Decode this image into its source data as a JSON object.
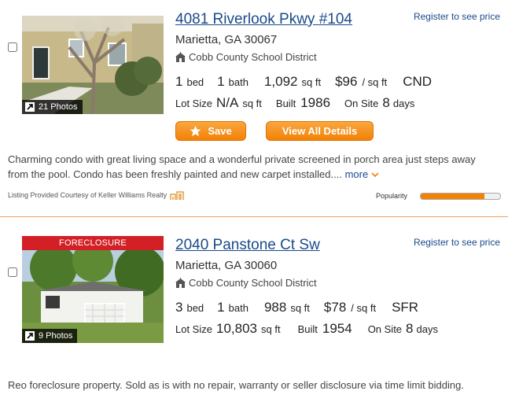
{
  "listings": [
    {
      "address": "4081 Riverlook Pkwy #104",
      "register_text": "Register to see price",
      "city": "Marietta, GA 30067",
      "school": "Cobb County School District",
      "beds_value": "1",
      "beds_label": "bed",
      "baths_value": "1",
      "baths_label": "bath",
      "sqft_value": "1,092",
      "sqft_label": "sq ft",
      "price_per_sqft": "$96",
      "price_per_sqft_label": "/ sq ft",
      "type": "CND",
      "lot_label": "Lot Size",
      "lot_value": "N/A",
      "lot_unit": "sq ft",
      "built_label": "Built",
      "built_value": "1986",
      "onsite_label": "On Site",
      "onsite_value": "8",
      "onsite_unit": "days",
      "photos": "21 Photos",
      "save_label": "Save",
      "details_label": "View All Details",
      "description": "Charming condo with great living space and a wonderful private screened in porch area just steps away from the pool. Condo has been freshly painted and new carpet installed....",
      "more_label": "more",
      "courtesy": "Listing Provided Courtesy of Keller Williams Realty",
      "popularity_label": "Popularity",
      "popularity": 0.8
    },
    {
      "banner": "FORECLOSURE",
      "address": "2040 Panstone Ct Sw",
      "register_text": "Register to see price",
      "city": "Marietta, GA 30060",
      "school": "Cobb County School District",
      "beds_value": "3",
      "beds_label": "bed",
      "baths_value": "1",
      "baths_label": "bath",
      "sqft_value": "988",
      "sqft_label": "sq ft",
      "price_per_sqft": "$78",
      "price_per_sqft_label": "/ sq ft",
      "type": "SFR",
      "lot_label": "Lot Size",
      "lot_value": "10,803",
      "lot_unit": "sq ft",
      "built_label": "Built",
      "built_value": "1954",
      "onsite_label": "On Site",
      "onsite_value": "8",
      "onsite_unit": "days",
      "photos": "9 Photos",
      "description": "Reo foreclosure property. Sold as is with no repair, warranty or seller disclosure via time limit bidding."
    }
  ],
  "colors": {
    "accent": "#f28205",
    "link": "#1a4a8a",
    "banner": "#d31f26"
  }
}
